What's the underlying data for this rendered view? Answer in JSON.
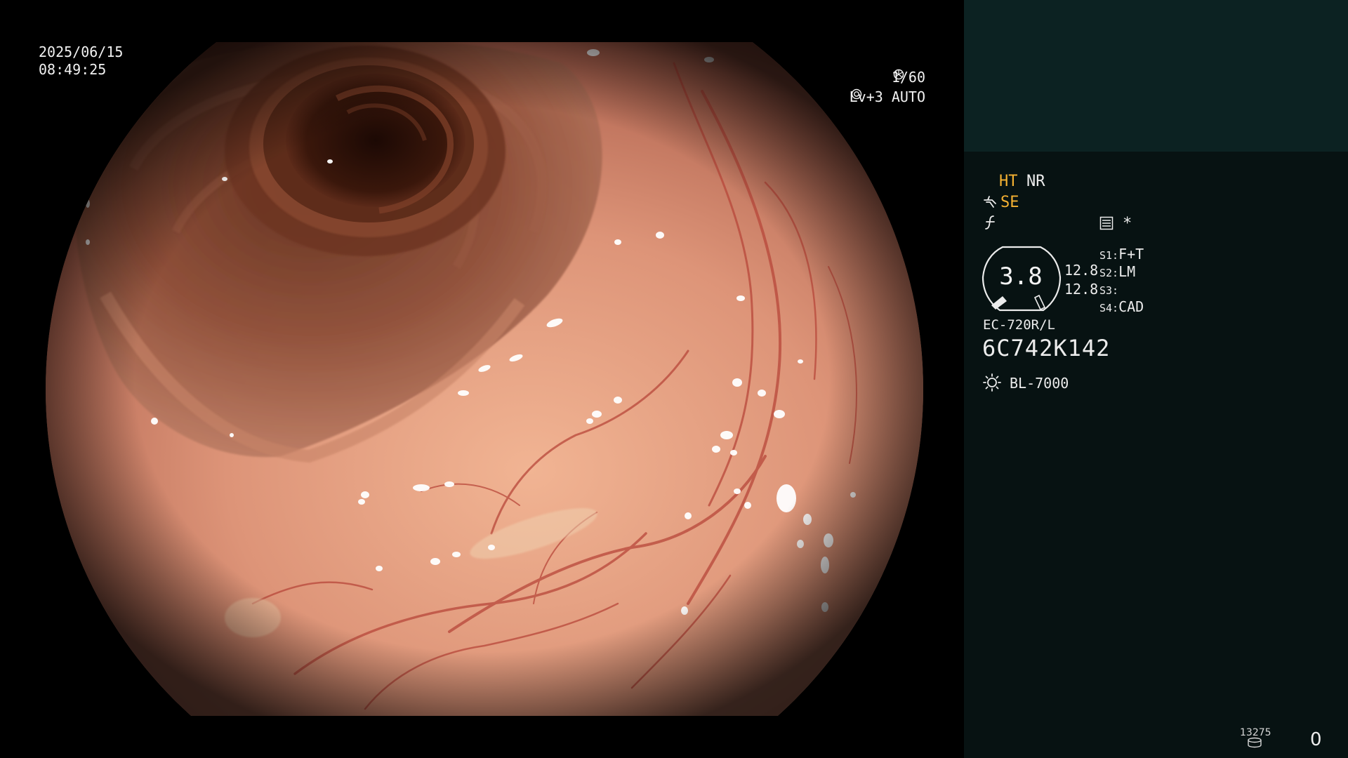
{
  "overlay": {
    "date": "2025/06/15",
    "time": "08:49:25",
    "shutter": "1/60",
    "exposure": "Lv+3 AUTO"
  },
  "panel": {
    "modes": {
      "ht": "HT",
      "nr": "NR",
      "se": "SE",
      "star": "*"
    },
    "gauge": {
      "value": "3.8",
      "value_1": "12.8",
      "value_2": "12.8"
    },
    "switches": [
      {
        "key": "S1:",
        "value": "F+T"
      },
      {
        "key": "S2:",
        "value": "LM"
      },
      {
        "key": "S3:",
        "value": ""
      },
      {
        "key": "S4:",
        "value": "CAD"
      }
    ],
    "scope_model": "EC-720R/L",
    "scope_serial": "6C742K142",
    "light_source": "BL-7000",
    "counter": "13275",
    "frame": "0"
  },
  "colors": {
    "panel_background": "#071212",
    "panel_top_block": "#0c2222",
    "highlight_orange": "#f5b132",
    "tissue": "#d9917a",
    "lumen_dark": "#2e1208"
  },
  "icons": {
    "shutter": "shutter-icon",
    "auto_exposure": "auto-exposure-icon",
    "structure_enhance": "structure-enhance-icon",
    "freeze": "freeze-icon",
    "menu": "menu-icon",
    "light_source": "light-source-icon",
    "storage": "storage-icon"
  }
}
